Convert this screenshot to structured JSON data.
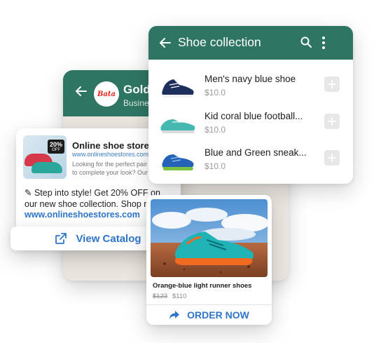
{
  "chat": {
    "brand_logo_text": "Bata",
    "name": "Golde",
    "subtitle": "Business"
  },
  "message": {
    "badge_percent": "20%",
    "badge_off": "OFF",
    "promo_title": "Online shoe stores",
    "promo_url": "www.onlineshoestores.com",
    "promo_desc_line1": "Looking for the perfect pair",
    "promo_desc_line2": "to complete your look? Our",
    "body": "✎ Step into style! Get 20% OFF on our new shoe collection. Shop now at:",
    "link": "www.onlineshoestores.com"
  },
  "view_catalog": {
    "label": "View Catalog",
    "icon": "external-link-icon"
  },
  "collection": {
    "title": "Shoe collection",
    "products": [
      {
        "name": "Men's navy blue shoe",
        "price": "$10.0",
        "color": "#1f2f5c"
      },
      {
        "name": "Kid coral blue football...",
        "price": "$10.0",
        "color": "#45b8b0"
      },
      {
        "name": "Blue and Green sneak...",
        "price": "$10.0",
        "color": "#2563b8"
      }
    ]
  },
  "product": {
    "name": "Orange-blue light runner shoes",
    "old_price": "$123",
    "new_price": "$110",
    "order_label": "ORDER NOW"
  },
  "colors": {
    "brand_green": "#2f7563",
    "link_blue": "#2e75c9",
    "chat_bg": "#ebe6e0"
  }
}
